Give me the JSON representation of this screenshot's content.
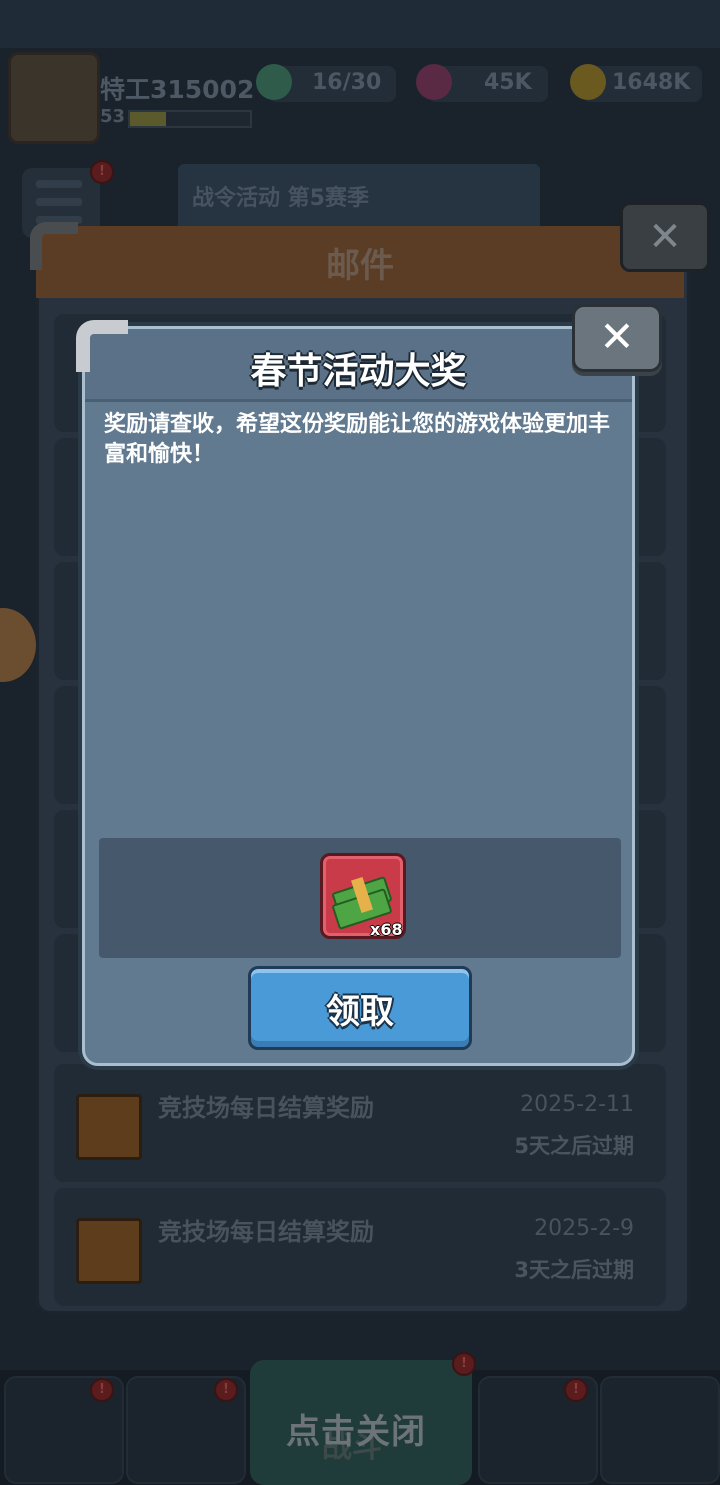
{
  "player": {
    "name": "特工315002",
    "level": "53",
    "xp_fraction": 0.3
  },
  "resources": [
    {
      "icon": "energy-potion-icon",
      "value": "16/30"
    },
    {
      "icon": "gem-icon",
      "value": "45K"
    },
    {
      "icon": "gold-coin-icon",
      "value": "1648K"
    }
  ],
  "banner": {
    "text": "战令活动 第5赛季"
  },
  "mail_window": {
    "title": "邮件",
    "close_glyph": "✕",
    "rows": [
      {
        "title": "竞技场每日结算奖励",
        "date": "2025-2-11",
        "expire": "5天之后过期"
      },
      {
        "title": "竞技场每日结算奖励",
        "date": "2025-2-9",
        "expire": "3天之后过期"
      }
    ]
  },
  "dialog": {
    "title": "春节活动大奖",
    "message": "奖励请查收，希望这份奖励能让您的游戏体验更加丰富和愉快！",
    "close_glyph": "✕",
    "reward": {
      "icon": "cash-bundle-icon",
      "quantity": "x68"
    },
    "claim_label": "领取"
  },
  "bottom": {
    "tap_to_close": "点击关闭",
    "center_tab": "战斗"
  },
  "colors": {
    "dialog_bg": "#617a90",
    "claim_button": "#4a9ad8",
    "reward_frame": "#c93b48",
    "mail_header": "#5b3d26"
  }
}
